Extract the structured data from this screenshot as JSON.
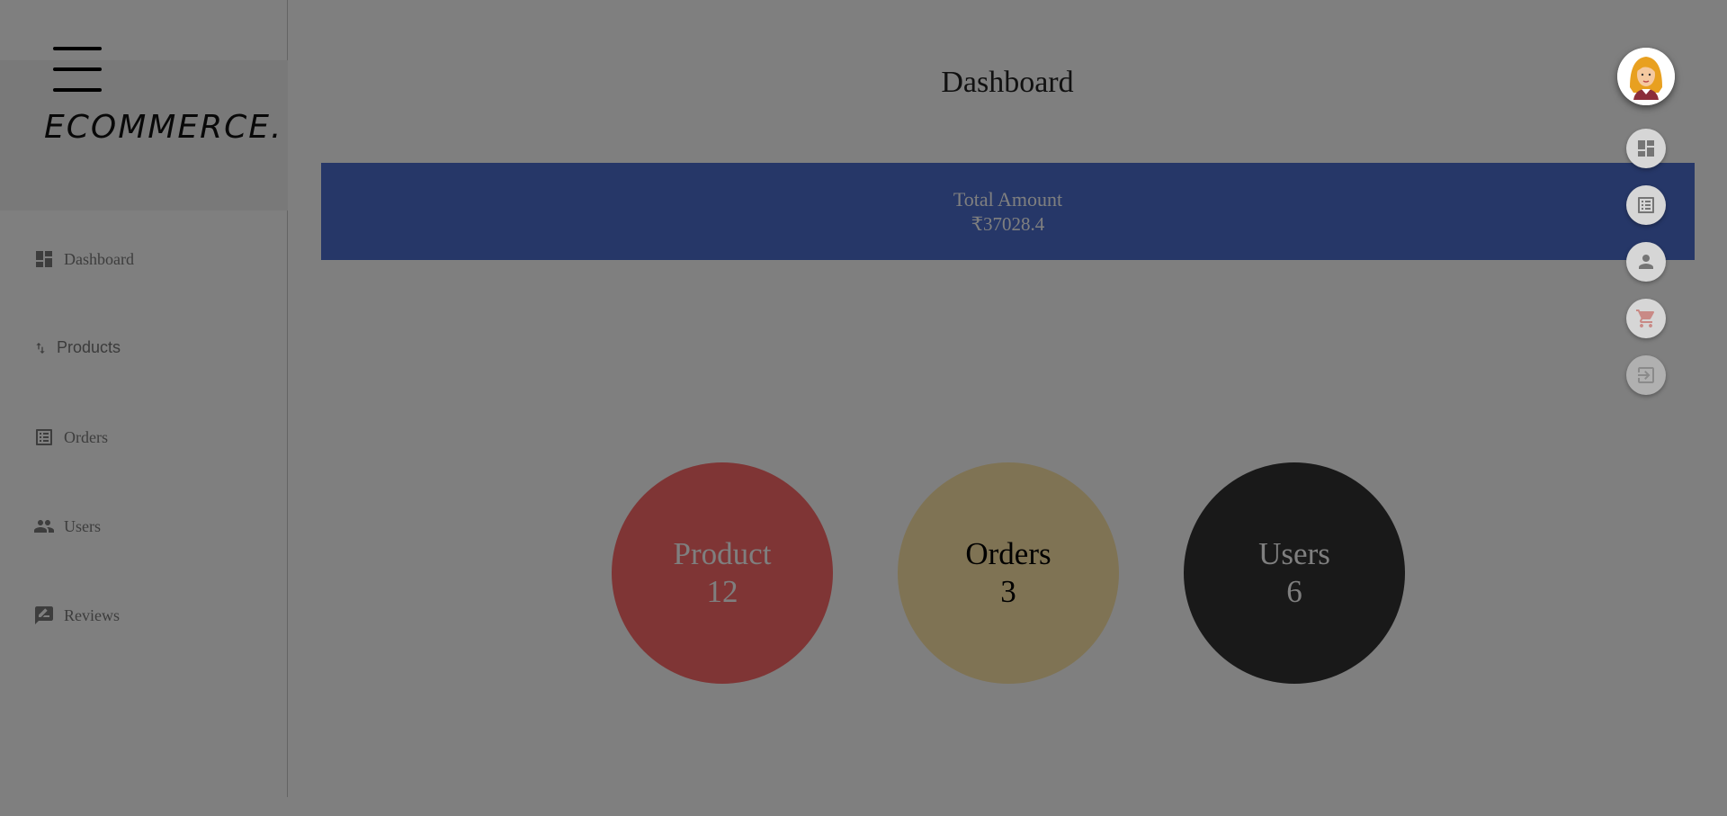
{
  "app": {
    "logo": "ECOMMERCE."
  },
  "sidebar": {
    "items": [
      {
        "label": "Dashboard",
        "icon": "dashboard-icon"
      },
      {
        "label": "Products",
        "icon": "import-export-icon"
      },
      {
        "label": "Orders",
        "icon": "list-alt-icon"
      },
      {
        "label": "Users",
        "icon": "people-icon"
      },
      {
        "label": "Reviews",
        "icon": "rate-review-icon"
      }
    ]
  },
  "main": {
    "title": "Dashboard",
    "total": {
      "label": "Total Amount",
      "value": "₹37028.4"
    },
    "stats": [
      {
        "label": "Product",
        "value": "12"
      },
      {
        "label": "Orders",
        "value": "3"
      },
      {
        "label": "Users",
        "value": "6"
      }
    ]
  },
  "speed_dial": {
    "actions": [
      "dashboard-icon",
      "list-alt-icon",
      "person-icon",
      "shopping-cart-icon",
      "exit-to-app-icon"
    ]
  },
  "colors": {
    "total_bg": "#4c6fd0",
    "product_bg": "#ff6b6b",
    "orders_bg": "#ffe6a8",
    "users_bg": "#333333",
    "overlay": "rgba(0,0,0,0.5)"
  }
}
